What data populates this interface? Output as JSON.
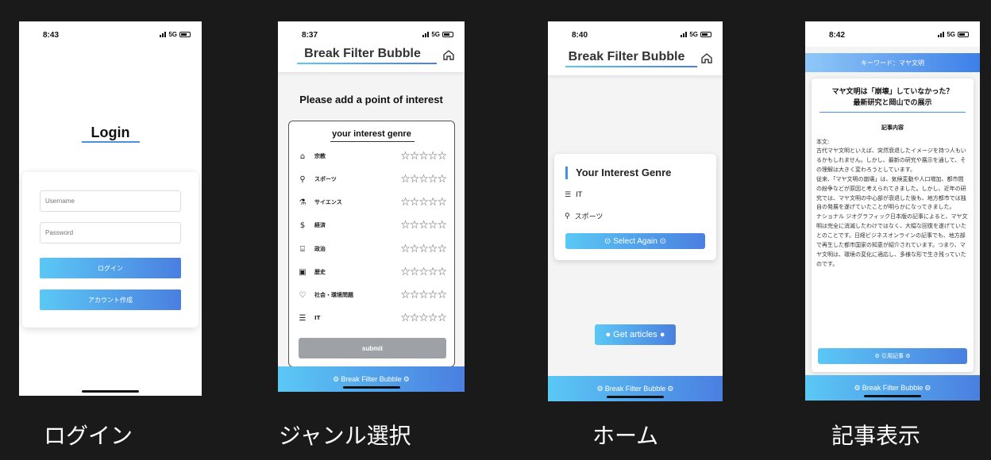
{
  "status_bar": {
    "network": "5G",
    "times": [
      "8:43",
      "8:37",
      "8:40",
      "8:42"
    ]
  },
  "app": {
    "header_title": "Break Filter Bubble",
    "footer_label": "Break Filter Bubble"
  },
  "captions": [
    "ログイン",
    "ジャンル選択",
    "ホーム",
    "記事表示"
  ],
  "login": {
    "title": "Login",
    "username_placeholder": "Username",
    "password_placeholder": "Password",
    "login_button": "ログイン",
    "create_account_button": "アカウント作成"
  },
  "genre_select": {
    "prompt": "Please add a point of interest",
    "box_title": "your interest genre",
    "genres": [
      {
        "icon": "temple-icon",
        "label": "宗教",
        "rating": 0
      },
      {
        "icon": "bicycle-icon",
        "label": "スポーツ",
        "rating": 0
      },
      {
        "icon": "flask-icon",
        "label": "サイエンス",
        "rating": 0
      },
      {
        "icon": "dollar-icon",
        "label": "経済",
        "rating": 0
      },
      {
        "icon": "bank-icon",
        "label": "政治",
        "rating": 0
      },
      {
        "icon": "history-icon",
        "label": "歴史",
        "rating": 0
      },
      {
        "icon": "handshake-icon",
        "label": "社会・環境問題",
        "rating": 0
      },
      {
        "icon": "server-icon",
        "label": "IT",
        "rating": 0
      }
    ],
    "submit": "submit"
  },
  "home": {
    "card_title": "Your Interest Genre",
    "genres": [
      "IT",
      "スポーツ"
    ],
    "select_again": "Select Again",
    "get_articles": "Get articles"
  },
  "article": {
    "keyword_bar": "キーワード：マヤ文明",
    "title_line1": "マヤ文明は「崩壊」していなかった？",
    "title_line2": "最新研究と岡山での展示",
    "section": "記事内容",
    "body_label": "本文:",
    "body": "古代マヤ文明といえば、突然衰退したイメージを持つ人もいるかもしれません。しかし、最新の研究や展示を通して、その理解は大きく変わろうとしています。\n従来、「マヤ文明の崩壊」は、気候変動や人口増加、都市間の紛争などが原因と考えられてきました。しかし、近年の研究では、マヤ文明の中心部が衰退した後も、地方都市では独自の発展を遂げていたことが明らかになってきました。\nナショナル ジオグラフィック日本版の記事によると、マヤ文明は完全に消滅したわけではなく、大幅な回復を遂げていたとのことです。日経ビジネスオンラインの記事でも、地方部で再生した都市国家の知恵が紹介されています。つまり、マヤ文明は、環境の変化に適応し、多様な形で生き残っていたのです。",
    "cite_button": "引用記事"
  },
  "colors": {
    "accent_start": "#5bc8f5",
    "accent_end": "#4a7fe0",
    "background": "#1a1a1a"
  }
}
